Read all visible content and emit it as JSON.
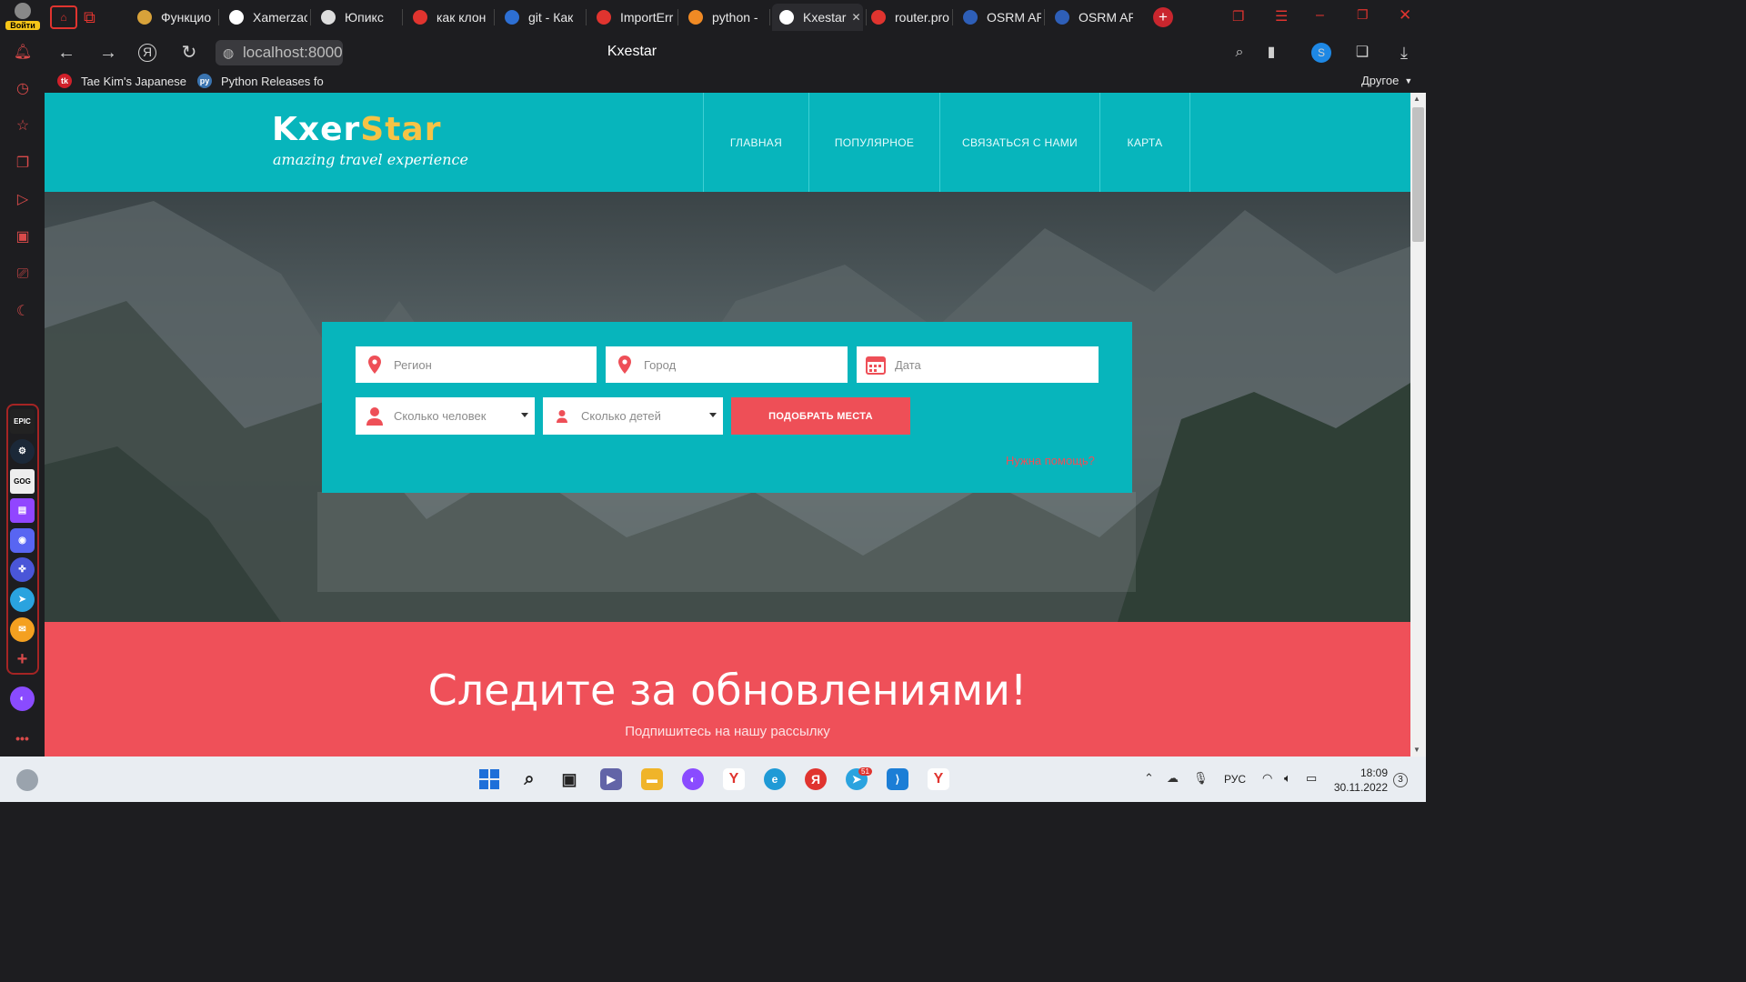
{
  "browser": {
    "login_label": "Войти",
    "tabs": [
      {
        "label": "Функцио",
        "color": "#d8a23a"
      },
      {
        "label": "Xamerzac",
        "color": "#ffffff"
      },
      {
        "label": "Юпикс",
        "color": "#dddddd"
      },
      {
        "label": "как клон",
        "color": "#e0342f"
      },
      {
        "label": "git - Как",
        "color": "#2d6fd3"
      },
      {
        "label": "ImportErr",
        "color": "#e0342f"
      },
      {
        "label": "python -",
        "color": "#f08a24"
      },
      {
        "label": "Kxestar",
        "color": "#ffffff"
      },
      {
        "label": "router.pro",
        "color": "#e0342f"
      },
      {
        "label": "OSRM AP",
        "color": "#2e5fb8"
      },
      {
        "label": "OSRM AP",
        "color": "#2e5fb8"
      }
    ],
    "url": "localhost:8000",
    "page_title": "Kxestar",
    "bookmarks": [
      {
        "label": "Tae Kim's Japanese",
        "icon_text": "tk",
        "color": "#d0202a"
      },
      {
        "label": "Python Releases fo",
        "icon_text": "py",
        "color": "#3a74b0"
      }
    ],
    "other_bookmarks": "Другое"
  },
  "site": {
    "logo_main": "Kxer",
    "logo_accent": "Star",
    "logo_tagline": "amazing travel experience",
    "nav": [
      "ГЛАВНАЯ",
      "ПОПУЛЯРНОЕ",
      "СВЯЗАТЬСЯ С НАМИ",
      "КАРТА"
    ],
    "search": {
      "region_placeholder": "Регион",
      "city_placeholder": "Город",
      "date_placeholder": "Дата",
      "people_placeholder": "Сколько человек",
      "children_placeholder": "Сколько детей",
      "submit_label": "ПОДОБРАТЬ МЕСТА",
      "help_link": "Нужна помощь?"
    },
    "newsletter": {
      "title": "Следите за обновлениями!",
      "subtitle": "Подпишитесь на нашу рассылку"
    },
    "colors": {
      "teal": "#07b5bc",
      "coral": "#ef5059",
      "logo_yellow": "#f6c346"
    }
  },
  "taskbar": {
    "language": "РУС",
    "time": "18:09",
    "date": "30.11.2022",
    "notification_count": "3",
    "telegram_badge": "51"
  }
}
